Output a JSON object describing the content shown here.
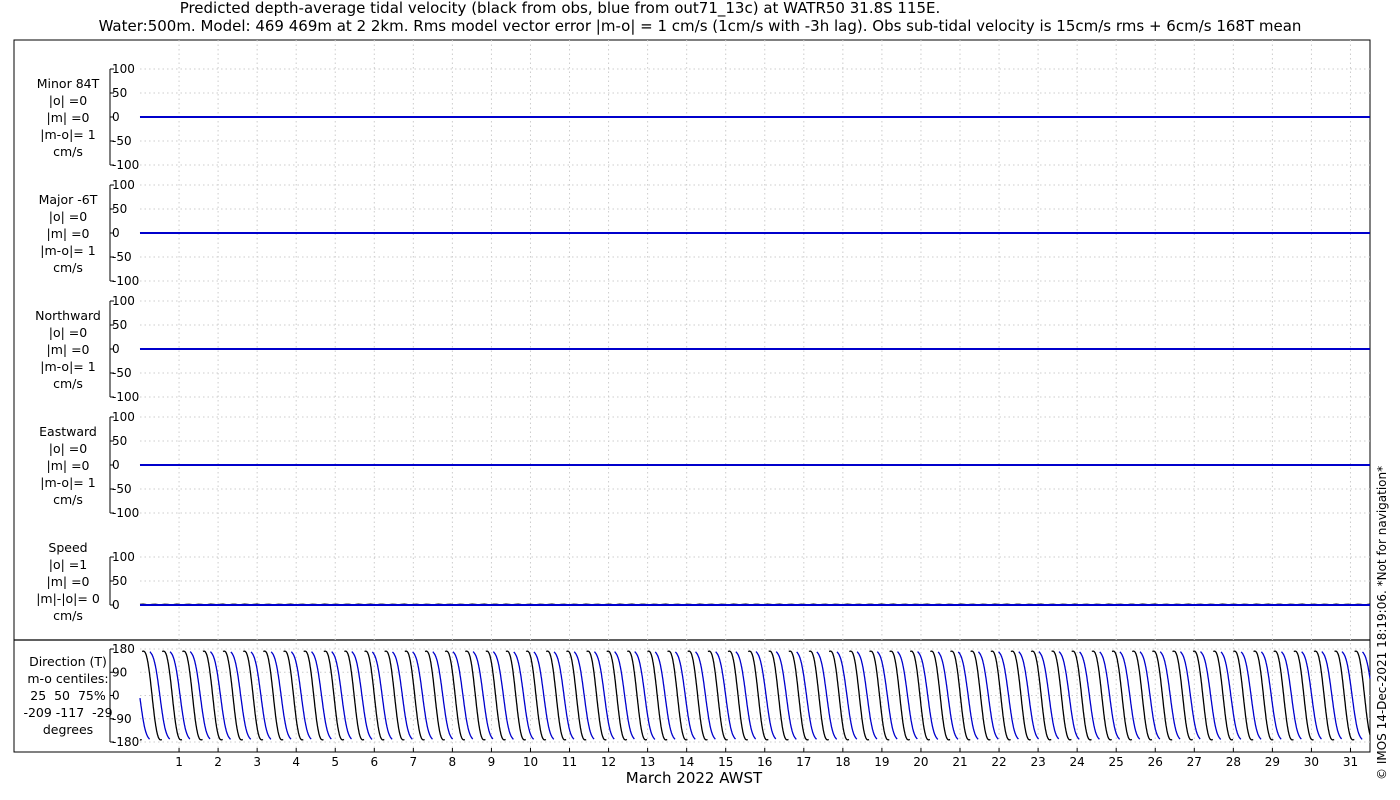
{
  "title": {
    "line1": "Predicted depth-average tidal velocity (black from obs, blue from out71_13c) at WATR50 31.8S 115E.",
    "line2": "Water:500m. Model: 469 469m at 2 2km. Rms model vector error |m-o| = 1 cm/s (1cm/s with -3h lag). Obs sub-tidal velocity is 15cm/s rms + 6cm/s 168T mean"
  },
  "copyright": "© IMOS 14-Dec-2021 18:19:06. *Not for navigation*",
  "colors": {
    "obs": "#000000",
    "model": "#0000cc",
    "grid": "#cccccc",
    "axis": "#000000"
  },
  "chart_data": {
    "type": "line",
    "xlabel": "March 2022 AWST",
    "x_ticks": [
      "1",
      "2",
      "3",
      "4",
      "5",
      "6",
      "7",
      "8",
      "9",
      "10",
      "11",
      "12",
      "13",
      "14",
      "15",
      "16",
      "17",
      "18",
      "19",
      "20",
      "21",
      "22",
      "23",
      "24",
      "25",
      "26",
      "27",
      "28",
      "29",
      "30",
      "31"
    ],
    "xlim": [
      0,
      31.5
    ],
    "grid": true,
    "series": [
      {
        "name": "black from obs",
        "color": "#000000"
      },
      {
        "name": "blue from out71_13c",
        "color": "#0000cc"
      }
    ],
    "panels": [
      {
        "label": "Minor 84T\n|o| =0\n|m| =0\n|m-o|= 1\ncm/s",
        "ylim": [
          -100,
          100
        ],
        "yticks": [
          "100",
          "50",
          "0",
          "-50",
          "-100"
        ],
        "obs_level": 0,
        "model_level": 0
      },
      {
        "label": "Major -6T\n|o| =0\n|m| =0\n|m-o|= 1\ncm/s",
        "ylim": [
          -100,
          100
        ],
        "yticks": [
          "100",
          "50",
          "0",
          "-50",
          "-100"
        ],
        "obs_level": 0,
        "model_level": 0
      },
      {
        "label": "Northward\n|o| =0\n|m| =0\n|m-o|= 1\ncm/s",
        "ylim": [
          -100,
          100
        ],
        "yticks": [
          "100",
          "50",
          "0",
          "-50",
          "-100"
        ],
        "obs_level": 0,
        "model_level": 0
      },
      {
        "label": "Eastward\n|o| =0\n|m| =0\n|m-o|= 1\ncm/s",
        "ylim": [
          -100,
          100
        ],
        "yticks": [
          "100",
          "50",
          "0",
          "-50",
          "-100"
        ],
        "obs_level": 0,
        "model_level": 0
      },
      {
        "label": "Speed\n|o| =1\n|m| =0\n|m|-|o|= 0\ncm/s",
        "ylim": [
          0,
          100
        ],
        "yticks": [
          "100",
          "50",
          "0"
        ],
        "obs_level": 1,
        "model_level": 0
      }
    ],
    "direction_panel": {
      "label": "Direction (T)\nm-o centiles:\n25  50  75%\n-209 -117  -29\ndegrees",
      "ylim": [
        -180,
        180
      ],
      "yticks": [
        "180",
        "90",
        "0",
        "-90",
        "-180"
      ],
      "semidiurnal_period_days": 0.5175,
      "obs_phase_days": 0.05,
      "model_phase_days": 0.25
    }
  }
}
